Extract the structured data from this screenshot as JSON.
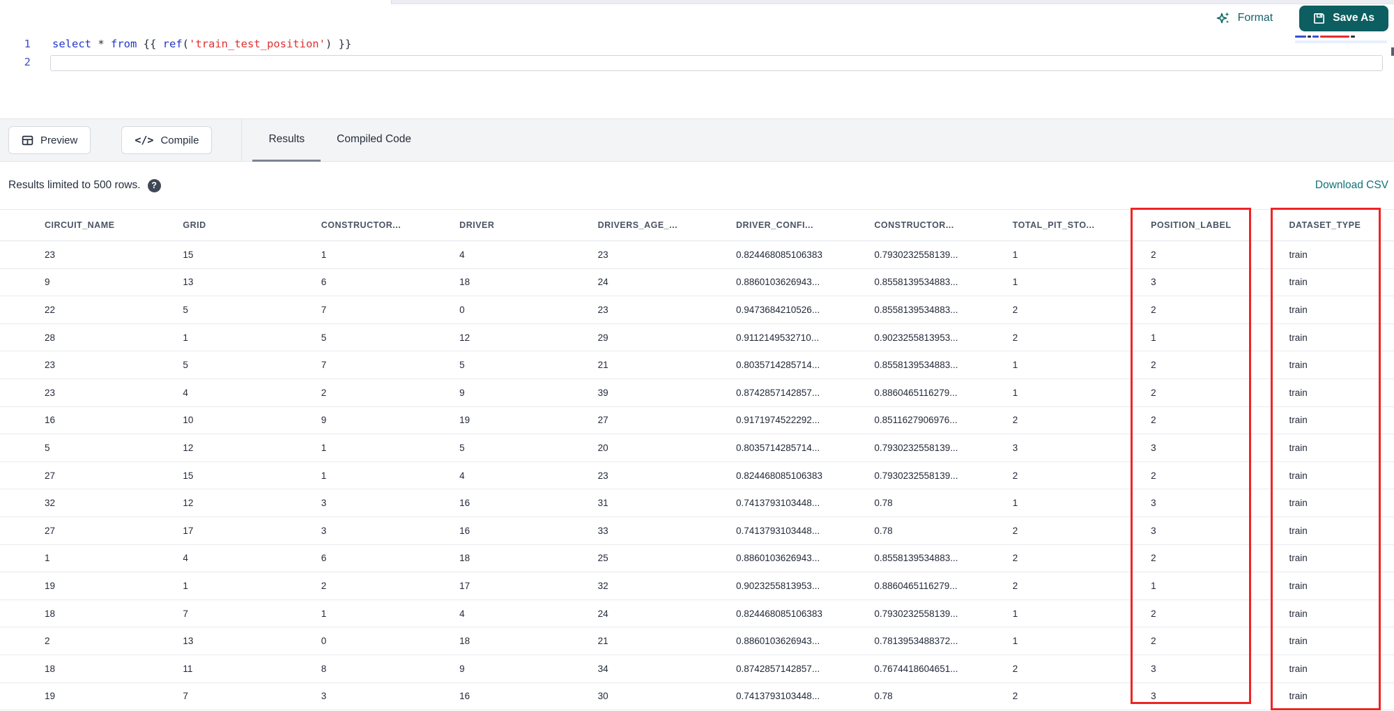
{
  "colors": {
    "teal": "#0c5e60",
    "red_highlight": "#ee2424",
    "link_teal": "#0f7277"
  },
  "top_bar": {
    "format_label": "Format",
    "save_as_label": "Save As"
  },
  "editor": {
    "lines": [
      {
        "number": "1",
        "tokens": [
          {
            "c": "kw",
            "t": "select"
          },
          {
            "c": "pl",
            "t": " * "
          },
          {
            "c": "kw",
            "t": "from"
          },
          {
            "c": "pl",
            "t": " {{ "
          },
          {
            "c": "kw",
            "t": "ref"
          },
          {
            "c": "pl",
            "t": "("
          },
          {
            "c": "str",
            "t": "'train_test_position'"
          },
          {
            "c": "pl",
            "t": ") }}"
          }
        ]
      },
      {
        "number": "2",
        "tokens": []
      }
    ]
  },
  "toolbar": {
    "preview_label": "Preview",
    "compile_label": "Compile",
    "compile_glyph": "</>",
    "tabs": [
      {
        "label": "Results",
        "active": true
      },
      {
        "label": "Compiled Code",
        "active": false
      }
    ]
  },
  "results_bar": {
    "limit_text": "Results limited to 500 rows.",
    "help_glyph": "?",
    "download_label": "Download CSV"
  },
  "table": {
    "columns": [
      "CIRCUIT_NAME",
      "GRID",
      "CONSTRUCTOR...",
      "DRIVER",
      "DRIVERS_AGE_...",
      "DRIVER_CONFI...",
      "CONSTRUCTOR...",
      "TOTAL_PIT_STO...",
      "POSITION_LABEL",
      "DATASET_TYPE"
    ],
    "highlighted_columns": [
      "POSITION_LABEL",
      "DATASET_TYPE"
    ],
    "rows": [
      [
        "23",
        "15",
        "1",
        "4",
        "23",
        "0.824468085106383",
        "0.7930232558139...",
        "1",
        "2",
        "train"
      ],
      [
        "9",
        "13",
        "6",
        "18",
        "24",
        "0.8860103626943...",
        "0.8558139534883...",
        "1",
        "3",
        "train"
      ],
      [
        "22",
        "5",
        "7",
        "0",
        "23",
        "0.9473684210526...",
        "0.8558139534883...",
        "2",
        "2",
        "train"
      ],
      [
        "28",
        "1",
        "5",
        "12",
        "29",
        "0.9112149532710...",
        "0.9023255813953...",
        "2",
        "1",
        "train"
      ],
      [
        "23",
        "5",
        "7",
        "5",
        "21",
        "0.8035714285714...",
        "0.8558139534883...",
        "1",
        "2",
        "train"
      ],
      [
        "23",
        "4",
        "2",
        "9",
        "39",
        "0.8742857142857...",
        "0.8860465116279...",
        "1",
        "2",
        "train"
      ],
      [
        "16",
        "10",
        "9",
        "19",
        "27",
        "0.9171974522292...",
        "0.8511627906976...",
        "2",
        "2",
        "train"
      ],
      [
        "5",
        "12",
        "1",
        "5",
        "20",
        "0.8035714285714...",
        "0.7930232558139...",
        "3",
        "3",
        "train"
      ],
      [
        "27",
        "15",
        "1",
        "4",
        "23",
        "0.824468085106383",
        "0.7930232558139...",
        "2",
        "2",
        "train"
      ],
      [
        "32",
        "12",
        "3",
        "16",
        "31",
        "0.7413793103448...",
        "0.78",
        "1",
        "3",
        "train"
      ],
      [
        "27",
        "17",
        "3",
        "16",
        "33",
        "0.7413793103448...",
        "0.78",
        "2",
        "3",
        "train"
      ],
      [
        "1",
        "4",
        "6",
        "18",
        "25",
        "0.8860103626943...",
        "0.8558139534883...",
        "2",
        "2",
        "train"
      ],
      [
        "19",
        "1",
        "2",
        "17",
        "32",
        "0.9023255813953...",
        "0.8860465116279...",
        "2",
        "1",
        "train"
      ],
      [
        "18",
        "7",
        "1",
        "4",
        "24",
        "0.824468085106383",
        "0.7930232558139...",
        "1",
        "2",
        "train"
      ],
      [
        "2",
        "13",
        "0",
        "18",
        "21",
        "0.8860103626943...",
        "0.7813953488372...",
        "1",
        "2",
        "train"
      ],
      [
        "18",
        "11",
        "8",
        "9",
        "34",
        "0.8742857142857...",
        "0.7674418604651...",
        "2",
        "3",
        "train"
      ],
      [
        "19",
        "7",
        "3",
        "16",
        "30",
        "0.7413793103448...",
        "0.78",
        "2",
        "3",
        "train"
      ]
    ]
  }
}
